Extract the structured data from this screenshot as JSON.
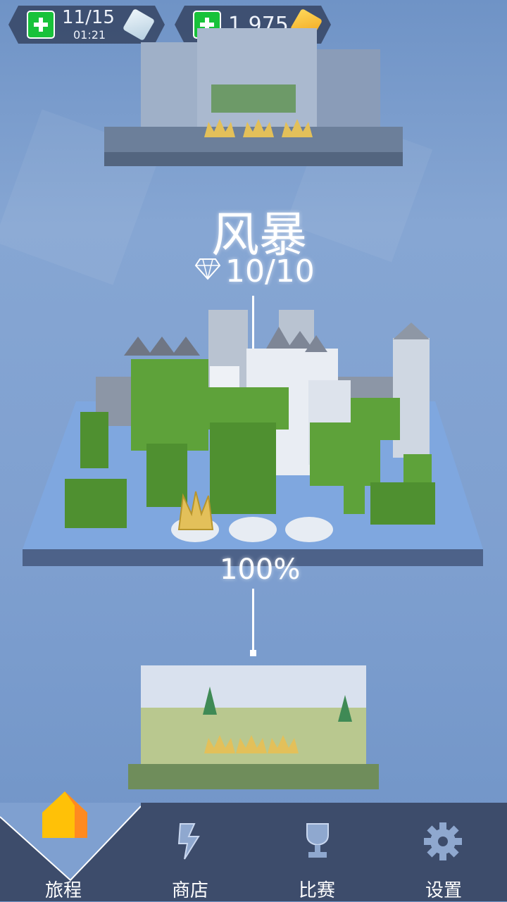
{
  "hud": {
    "lives": {
      "value": "11/15",
      "timer": "01:21",
      "plus_icon": "plus-icon",
      "icon": "ice-cube-icon"
    },
    "coins": {
      "value": "1,975",
      "plus_icon": "plus-icon",
      "icon": "gold-cube-icon"
    }
  },
  "level": {
    "name": "风暴",
    "gems": "10/10",
    "gem_icon": "diamond-icon",
    "progress": "100%",
    "crowns_earned": 1,
    "crowns_total": 3
  },
  "nav": {
    "items": [
      {
        "label": "旅程",
        "icon": "house-icon",
        "active": true
      },
      {
        "label": "商店",
        "icon": "shop-icon",
        "active": false
      },
      {
        "label": "比赛",
        "icon": "trophy-icon",
        "active": false
      },
      {
        "label": "设置",
        "icon": "gear-icon",
        "active": false
      }
    ]
  },
  "colors": {
    "accent": "#18c23a",
    "nav_bg": "#3d4c6b",
    "sky": "#7fa0d0",
    "grass": "#5ea23a",
    "gold": "#e3c05a"
  }
}
